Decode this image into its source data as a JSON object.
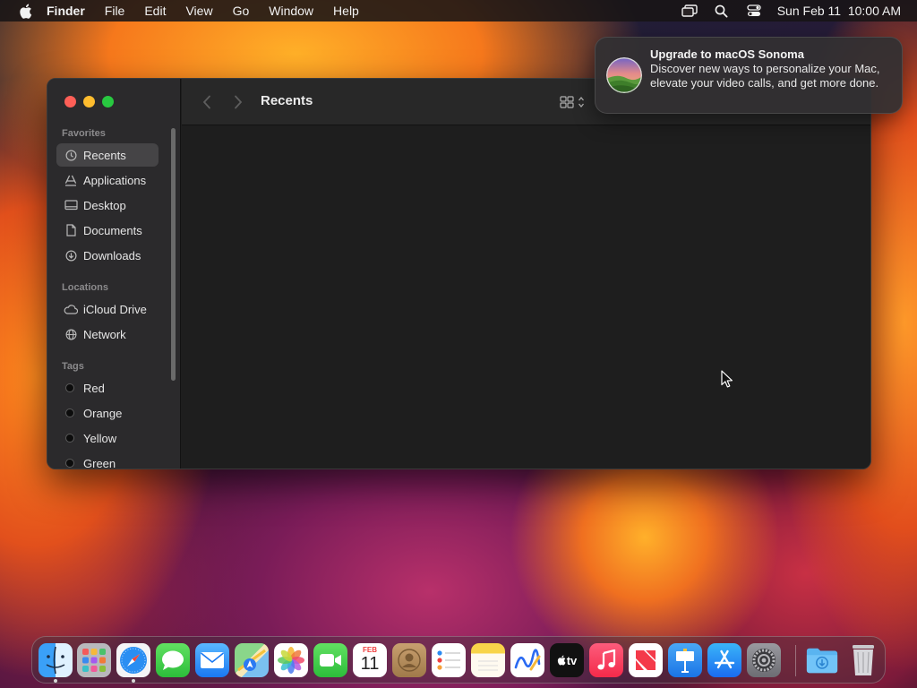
{
  "menubar": {
    "app": "Finder",
    "items": [
      "File",
      "Edit",
      "View",
      "Go",
      "Window",
      "Help"
    ],
    "clock": "Sun Feb 11  10:00 AM",
    "status_icons": [
      "screen-mirroring-icon",
      "spotlight-search-icon",
      "control-center-icon"
    ]
  },
  "finder": {
    "title": "Recents",
    "sections": {
      "favorites": "Favorites",
      "locations": "Locations",
      "tags": "Tags"
    },
    "favorites": [
      {
        "label": "Recents",
        "icon": "clock-icon",
        "active": true
      },
      {
        "label": "Applications",
        "icon": "applications-icon"
      },
      {
        "label": "Desktop",
        "icon": "desktop-icon"
      },
      {
        "label": "Documents",
        "icon": "document-icon"
      },
      {
        "label": "Downloads",
        "icon": "download-icon"
      }
    ],
    "locations": [
      {
        "label": "iCloud Drive",
        "icon": "cloud-icon"
      },
      {
        "label": "Network",
        "icon": "globe-icon"
      }
    ],
    "tags": [
      "Red",
      "Orange",
      "Yellow",
      "Green"
    ]
  },
  "notification": {
    "title": "Upgrade to macOS Sonoma",
    "body": "Discover new ways to personalize your Mac, elevate your video calls, and get more done."
  },
  "dock": {
    "calendar": {
      "month": "FEB",
      "day": "11"
    },
    "tv_label": "tv",
    "apps": [
      "Finder",
      "Launchpad",
      "Safari",
      "Messages",
      "Mail",
      "Maps",
      "Photos",
      "FaceTime",
      "Calendar",
      "Contacts",
      "Reminders",
      "Notes",
      "Freeform",
      "TV",
      "Music",
      "News",
      "Keynote",
      "App Store",
      "System Settings",
      "Downloads",
      "Trash"
    ]
  },
  "colors": {
    "accent": "#0a84ff",
    "traffic_red": "#fe5f57",
    "traffic_yellow": "#febc2e",
    "traffic_green": "#28c840"
  }
}
